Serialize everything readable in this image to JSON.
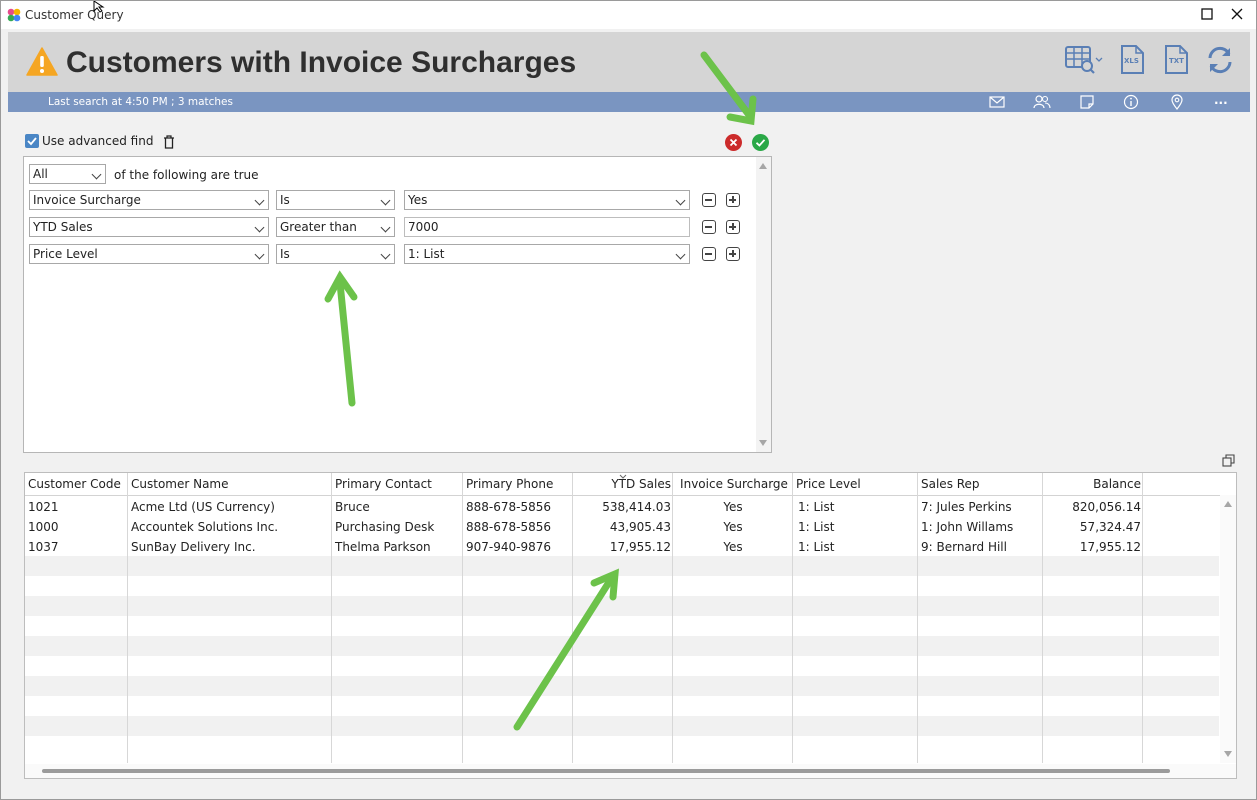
{
  "window": {
    "title": "Customer Query",
    "maximize_glyph": "☐",
    "close_glyph": "✕"
  },
  "header": {
    "title": "Customers with Invoice Surcharges",
    "status": "Last search at 4:50 PM ; 3 matches",
    "toolbar_icons": [
      "table-search-icon",
      "xls-export-icon",
      "txt-export-icon",
      "refresh-icon"
    ],
    "status_icons": [
      "email-icon",
      "contacts-icon",
      "note-icon",
      "info-icon",
      "location-icon",
      "more-icon"
    ],
    "more_label": "...",
    "xls_label": "XLS",
    "txt_label": "TXT"
  },
  "advanced": {
    "use_advanced_find_label": "Use advanced find",
    "checked": true
  },
  "criteria": {
    "match_mode": "All",
    "match_suffix": "of the following are true",
    "rows": [
      {
        "field": "Invoice Surcharge",
        "operator": "Is",
        "value": "Yes",
        "value_type": "select"
      },
      {
        "field": "YTD Sales",
        "operator": "Greater than",
        "value": "7000",
        "value_type": "text"
      },
      {
        "field": "Price Level",
        "operator": "Is",
        "value": "1: List",
        "value_type": "select"
      }
    ]
  },
  "grid": {
    "columns": [
      "Customer Code",
      "Customer Name",
      "Primary Contact",
      "Primary Phone",
      "YTD Sales",
      "Invoice Surcharge",
      "Price Level",
      "Sales Rep",
      "Balance"
    ],
    "sorted_column": "YTD Sales",
    "rows": [
      [
        "1021",
        "Acme Ltd (US Currency)",
        "Bruce",
        "888-678-5856",
        "538,414.03",
        "Yes",
        "1: List",
        "7: Jules Perkins",
        "820,056.14"
      ],
      [
        "1000",
        "Accountek Solutions Inc.",
        "Purchasing Desk",
        "888-678-5856",
        "43,905.43",
        "Yes",
        "1: List",
        "1: John Willams",
        "57,324.47"
      ],
      [
        "1037",
        "SunBay Delivery Inc.",
        "Thelma Parkson",
        "907-940-9876",
        "17,955.12",
        "Yes",
        "1: List",
        "9: Bernard Hill",
        "17,955.12"
      ]
    ]
  },
  "colors": {
    "header_bg": "#d5d5d5",
    "status_bg": "#7a95c1",
    "annotation_arrow": "#6cc24a",
    "cancel": "#cc2b2b",
    "ok": "#2aa847",
    "warning": "#f5a623"
  }
}
